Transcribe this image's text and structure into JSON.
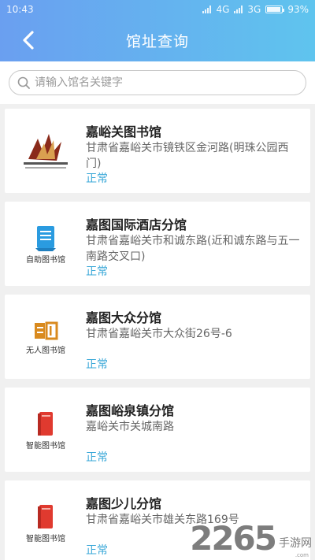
{
  "status_bar": {
    "time": "10:43",
    "network_1": "4G",
    "network_2": "3G",
    "battery": "93%"
  },
  "header": {
    "title": "馆址查询",
    "back_icon": "chevron-left-icon"
  },
  "search": {
    "placeholder": "请输入馆名关键字",
    "icon": "search-icon"
  },
  "libraries": [
    {
      "name": "嘉峪关图书馆",
      "address": "甘肃省嘉峪关市镜铁区金河路(明珠公园西门)",
      "status": "正常",
      "logo": "jiayuguan-library-logo"
    },
    {
      "name": "嘉图国际酒店分馆",
      "address": "甘肃省嘉峪关市和诚东路(近和诚东路与五一南路交叉口)",
      "status": "正常",
      "logo": "self-service-library-logo",
      "logo_text": "自助图书馆"
    },
    {
      "name": "嘉图大众分馆",
      "address": "甘肃省嘉峪关市大众街26号-6",
      "status": "正常",
      "logo": "unmanned-library-logo",
      "logo_text": "无人图书馆"
    },
    {
      "name": "嘉图峪泉镇分馆",
      "address": "嘉峪关市关城南路",
      "status": "正常",
      "logo": "smart-library-logo",
      "logo_text": "智能图书馆"
    },
    {
      "name": "嘉图少儿分馆",
      "address": "甘肃省嘉峪关市雄关东路169号",
      "status": "正常",
      "logo": "smart-library-logo",
      "logo_text": "智能图书馆"
    }
  ],
  "watermark": {
    "number": "2265",
    "suffix": ".com",
    "label": "手游网"
  },
  "colors": {
    "header_start": "#6a9ff0",
    "header_end": "#5fc4ee",
    "status_text": "#3aa8d8",
    "smart_logo_red": "#e03a2f",
    "self_logo_blue": "#2a9be0",
    "unmanned_logo_orange": "#d98a1e"
  }
}
